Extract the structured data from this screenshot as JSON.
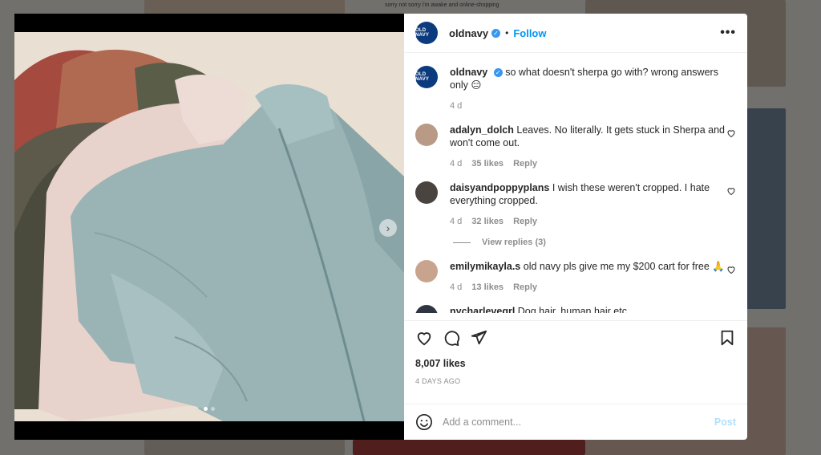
{
  "background": {
    "snippet": "sorry not sorry i'm awake and online-shopping"
  },
  "post": {
    "username": "oldnavy",
    "brand_avatar_text": "OLD NAVY",
    "follow_label": "Follow",
    "separator": "•",
    "more_icon": "more-horizontal-icon",
    "caption": "so what doesn't sherpa go with? wrong answers only 😑",
    "caption_time": "4 d",
    "likes": "8,007 likes",
    "date": "4 DAYS AGO",
    "carousel_next": "›",
    "carousel": {
      "count": 2,
      "active": 0
    }
  },
  "comments": [
    {
      "username": "adalyn_dolch",
      "text": "Leaves. No literally. It gets stuck in Sherpa and won't come out.",
      "time": "4 d",
      "likes": "35 likes",
      "reply": "Reply",
      "avatar_color": "#b89a86"
    },
    {
      "username": "daisyandpoppyplans",
      "text": "I wish these weren't cropped. I hate everything cropped.",
      "time": "4 d",
      "likes": "32 likes",
      "reply": "Reply",
      "avatar_color": "#4a4440"
    },
    {
      "username": "emilymikayla.s",
      "text": "old navy pls give me my $200 cart for free 🙏",
      "time": "4 d",
      "likes": "13 likes",
      "reply": "Reply",
      "avatar_color": "#c8a48e"
    },
    {
      "username": "nycharlevegrl",
      "text": "Dog hair, human hair etc",
      "avatar_color": "#2f3540"
    }
  ],
  "view_replies": "View replies (3)",
  "add_comment": {
    "placeholder": "Add a comment...",
    "post_label": "Post"
  },
  "colors": {
    "accent": "#0095f6",
    "post_disabled": "#b2dffc",
    "verified": "#3897f0",
    "brand": "#0b3a7e"
  }
}
